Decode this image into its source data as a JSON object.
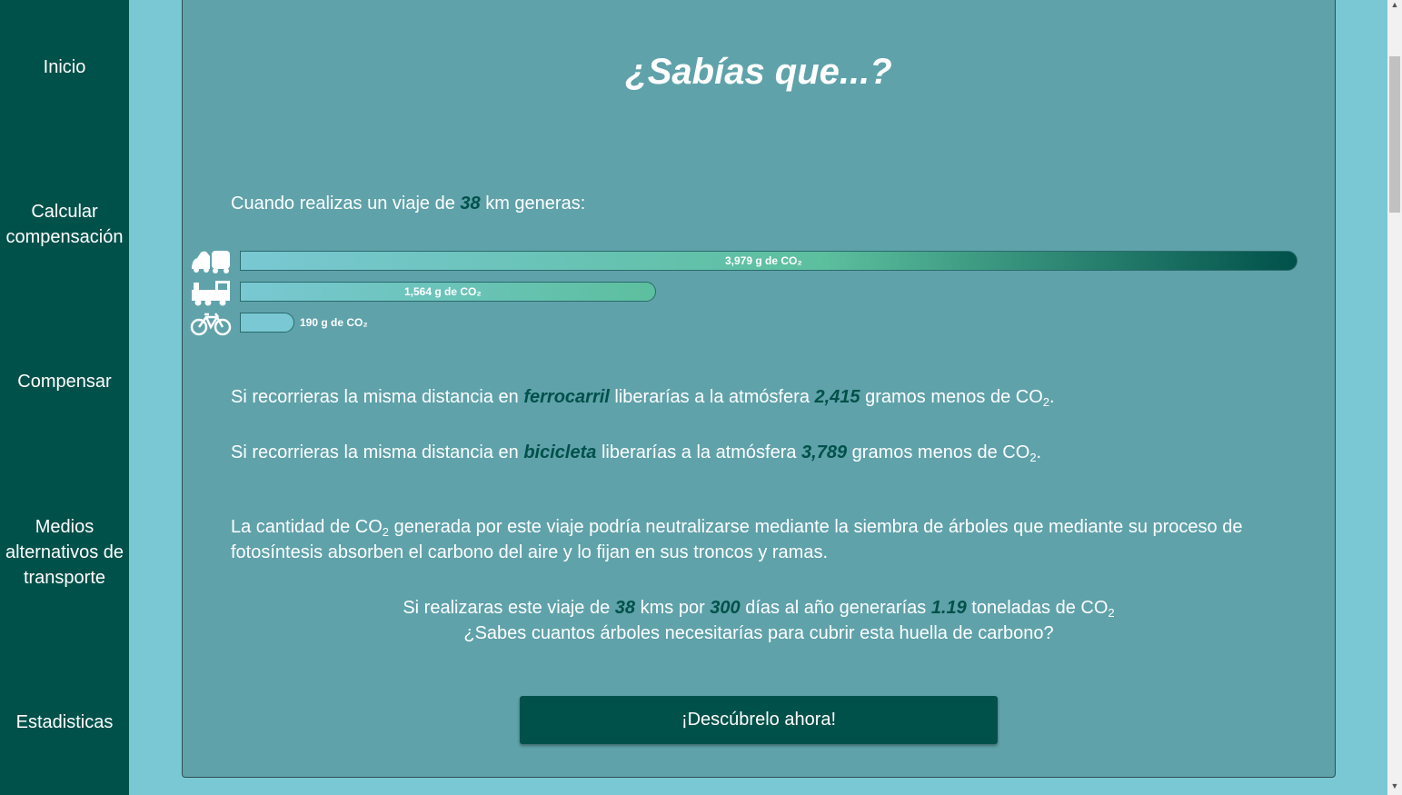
{
  "sidebar": {
    "items": [
      {
        "label_lines": [
          "Inicio"
        ]
      },
      {
        "label_lines": [
          "Calcular",
          "compensación"
        ]
      },
      {
        "label_lines": [
          "Compensar"
        ]
      },
      {
        "label_lines": [
          "Medios",
          "alternativos de",
          "transporte"
        ]
      },
      {
        "label_lines": [
          "Estadisticas"
        ]
      }
    ]
  },
  "main": {
    "title": "¿Sabías que...?",
    "intro": {
      "before": "Cuando realizas un viaje de ",
      "distance": "38",
      "after": " km generas:"
    },
    "chart_data": {
      "type": "bar",
      "orientation": "horizontal",
      "unit": "g de CO₂",
      "categories": [
        "car-icon",
        "train-icon",
        "bicycle-icon"
      ],
      "values": [
        3979,
        1564,
        190
      ],
      "labels": [
        "3,979 g de CO₂",
        "1,564 g de CO₂",
        "190 g de CO₂"
      ],
      "colors": {
        "start": "#79c8d3",
        "mid": "#5cbf9e",
        "end": "#00514a"
      }
    },
    "train_sentence": {
      "before": "Si recorrieras la misma distancia en ",
      "mode": "ferrocarril",
      "middle": " liberarías a la atmósfera ",
      "amount": "2,415",
      "after": " gramos menos de CO",
      "sub": "2",
      "end": "."
    },
    "bike_sentence": {
      "before": "Si recorrieras la misma distancia en ",
      "mode": "bicicleta",
      "middle": " liberarías a la atmósfera ",
      "amount": "3,789",
      "after": " gramos menos de CO",
      "sub": "2",
      "end": "."
    },
    "trees_paragraph": {
      "line1_before": "La cantidad de CO",
      "sub": "2",
      "line1_after": " generada por este viaje podría neutralizarse mediante la siembra de árboles que mediante su proceso de",
      "line2": "fotosíntesis absorben el carbono del aire y lo fijan en sus troncos y ramas."
    },
    "yearly": {
      "p1": "Si realizaras este viaje de ",
      "kms": "38",
      "p2": " kms por ",
      "days": "300",
      "p3": " días al año generarías ",
      "tons": "1.19",
      "p4": " toneladas de CO",
      "sub": "2",
      "question": "¿Sabes cuantos árboles necesitarías para cubrir esta huella de carbono?"
    },
    "cta_label": "¡Descúbrelo ahora!"
  },
  "colors": {
    "sidebar": "#00514a",
    "panel": "#5fa2aa",
    "page": "#79c8d3",
    "accent": "#00514a"
  }
}
